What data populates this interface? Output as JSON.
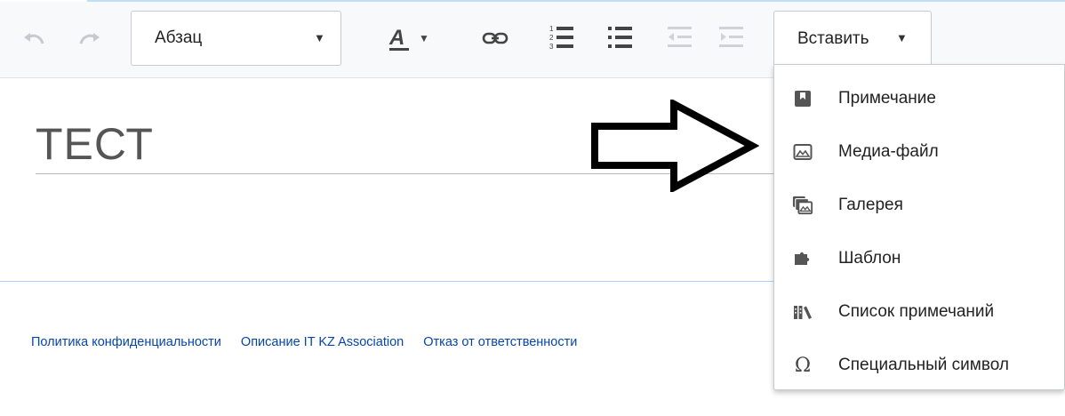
{
  "toolbar": {
    "format_select": {
      "value": "Абзац",
      "caret": "▼"
    },
    "text_style_caret": "▼",
    "insert_button": {
      "label": "Вставить",
      "caret": "▼"
    }
  },
  "document": {
    "title": "ТЕСТ"
  },
  "insert_menu": {
    "items": [
      {
        "label": "Примечание",
        "icon": "bookmark-icon"
      },
      {
        "label": "Медиа-файл",
        "icon": "image-icon"
      },
      {
        "label": "Галерея",
        "icon": "gallery-icon"
      },
      {
        "label": "Шаблон",
        "icon": "puzzle-icon"
      },
      {
        "label": "Список примечаний",
        "icon": "books-icon"
      },
      {
        "label": "Специальный символ",
        "icon": "omega-icon",
        "glyph": "Ω"
      }
    ]
  },
  "footer": {
    "links": [
      "Политика конфиденциальности",
      "Описание IT KZ Association",
      "Отказ от ответственности"
    ]
  },
  "colors": {
    "link": "#0645ad",
    "toolbar_bg": "#f8f9fa",
    "footer_rule": "#a7d7f0"
  }
}
